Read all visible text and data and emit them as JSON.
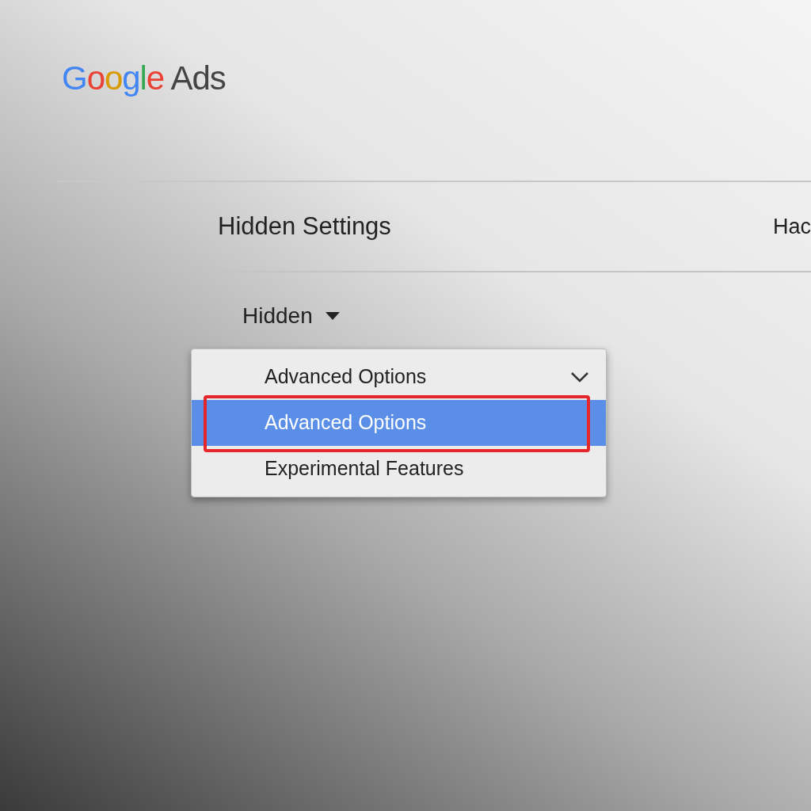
{
  "logo": {
    "brand": "Google",
    "product": "Ads"
  },
  "header": {
    "title": "Hidden Settings",
    "side_text": "Hac"
  },
  "dropdown": {
    "label": "Hidden",
    "expanded": true
  },
  "menu": [
    {
      "kind": "header",
      "label": "Advanced Options",
      "selected": false,
      "outlined": false
    },
    {
      "kind": "option",
      "label": "Advanced Options",
      "selected": true,
      "outlined": true
    },
    {
      "kind": "option",
      "label": "Experimental Features",
      "selected": false,
      "outlined": false
    }
  ]
}
